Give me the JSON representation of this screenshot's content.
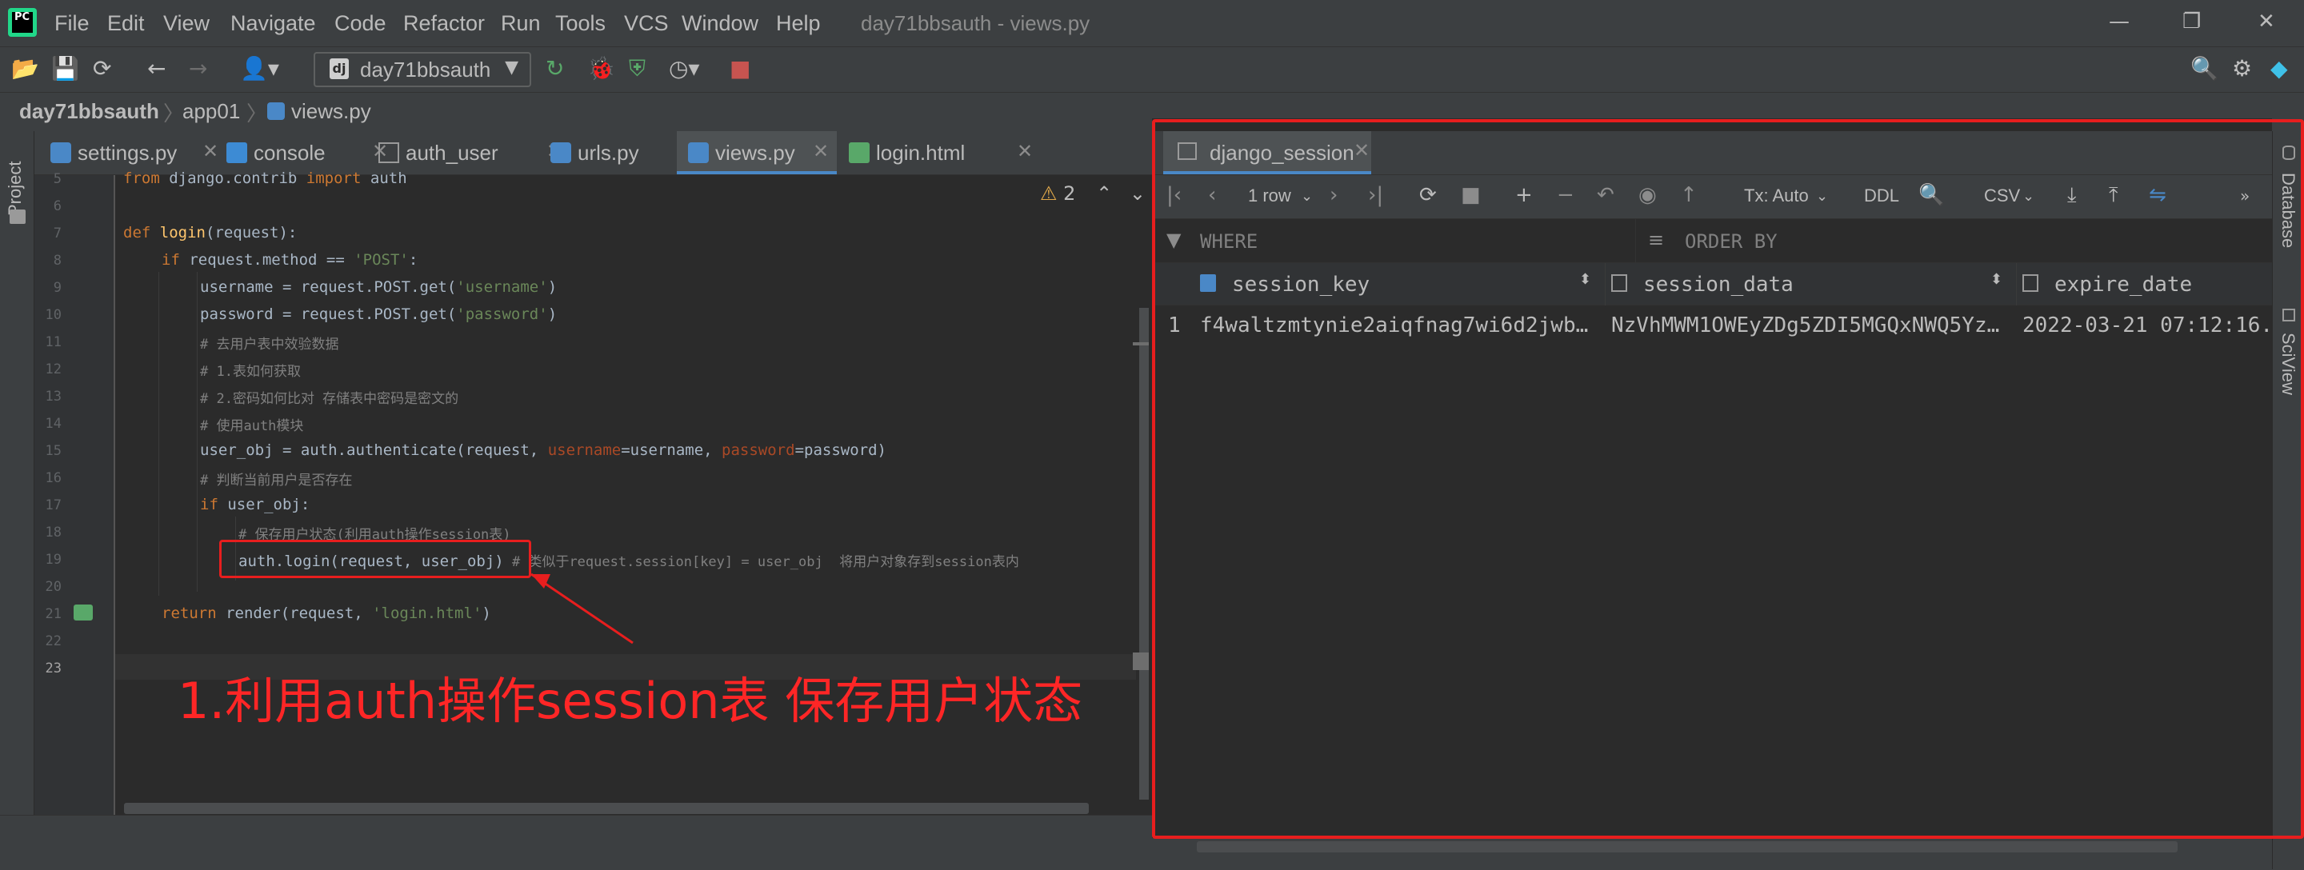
{
  "window": {
    "title": "day71bbsauth - views.py",
    "menu": [
      "File",
      "Edit",
      "View",
      "Navigate",
      "Code",
      "Refactor",
      "Run",
      "Tools",
      "VCS",
      "Window",
      "Help"
    ]
  },
  "toolbar": {
    "run_config": "day71bbsauth"
  },
  "breadcrumb": [
    "day71bbsauth",
    "app01",
    "views.py"
  ],
  "sidebar": {
    "left_tab": "Project",
    "right_tabs": [
      "Database",
      "SciView"
    ]
  },
  "editor_tabs": [
    {
      "label": "settings.py",
      "active": false
    },
    {
      "label": "console",
      "active": false
    },
    {
      "label": "auth_user",
      "active": false
    },
    {
      "label": "urls.py",
      "active": false
    },
    {
      "label": "views.py",
      "active": true
    },
    {
      "label": "login.html",
      "active": false
    }
  ],
  "editor": {
    "inspection_count": "2",
    "line_numbers": [
      "5",
      "6",
      "7",
      "8",
      "9",
      "10",
      "11",
      "12",
      "13",
      "14",
      "15",
      "16",
      "17",
      "18",
      "19",
      "20",
      "21",
      "22",
      "23"
    ],
    "code": {
      "l5_from": "from",
      "l5_mod": " django.contrib ",
      "l5_import": "import",
      "l5_name": " auth",
      "l7_def": "def",
      "l7_fn": "login",
      "l7_rest": "(request):",
      "l8_if": "if",
      "l8_mid": " request.method == ",
      "l8_str": "'POST'",
      "l8_end": ":",
      "l9_pre": "username = request.POST.get(",
      "l9_str": "'username'",
      "l9_end": ")",
      "l10_pre": "password = request.POST.get(",
      "l10_str": "'password'",
      "l10_end": ")",
      "l11": "# 去用户表中效验数据",
      "l12": "# 1.表如何获取",
      "l13": "# 2.密码如何比对 存储表中密码是密文的",
      "l14": "# 使用auth模块",
      "l15_pre": "user_obj = auth.authenticate(request, ",
      "l15_p1": "username",
      "l15_m1": "=username, ",
      "l15_p2": "password",
      "l15_m2": "=password)",
      "l16": "# 判断当前用户是否存在",
      "l17_if": "if",
      "l17_rest": " user_obj:",
      "l18": "# 保存用户状态(利用auth操作session表)",
      "l19_code": "auth.login(request, user_obj)",
      "l19_cm": " # 类似于request.session[key] = user_obj  将用户对象存到session表内",
      "l21_ret": "return",
      "l21_mid": " render(request, ",
      "l21_str": "'login.html'",
      "l21_end": ")"
    }
  },
  "annotation": {
    "text": "1.利用auth操作session表 保存用户状态",
    "color": "#ff2626"
  },
  "db_console": {
    "tab_label": "django_session",
    "row_count": "1 row",
    "tx_mode": "Tx: Auto",
    "ddl": "DDL",
    "export_format": "CSV",
    "where_placeholder": "WHERE",
    "order_by_placeholder": "ORDER BY",
    "columns": [
      "session_key",
      "session_data",
      "expire_date"
    ],
    "rows": [
      {
        "index": "1",
        "session_key": "f4waltzmtynie2aiqfnag7wi6d2jwb…",
        "session_data": "NzVhMWM1OWEyZDg5ZDI5MGQxNWQ5Yz…",
        "expire_date": "2022-03-21 07:12:16.…"
      }
    ]
  },
  "colors": {
    "accent": "#4a88c7",
    "highlight_box": "#e81e1e"
  }
}
